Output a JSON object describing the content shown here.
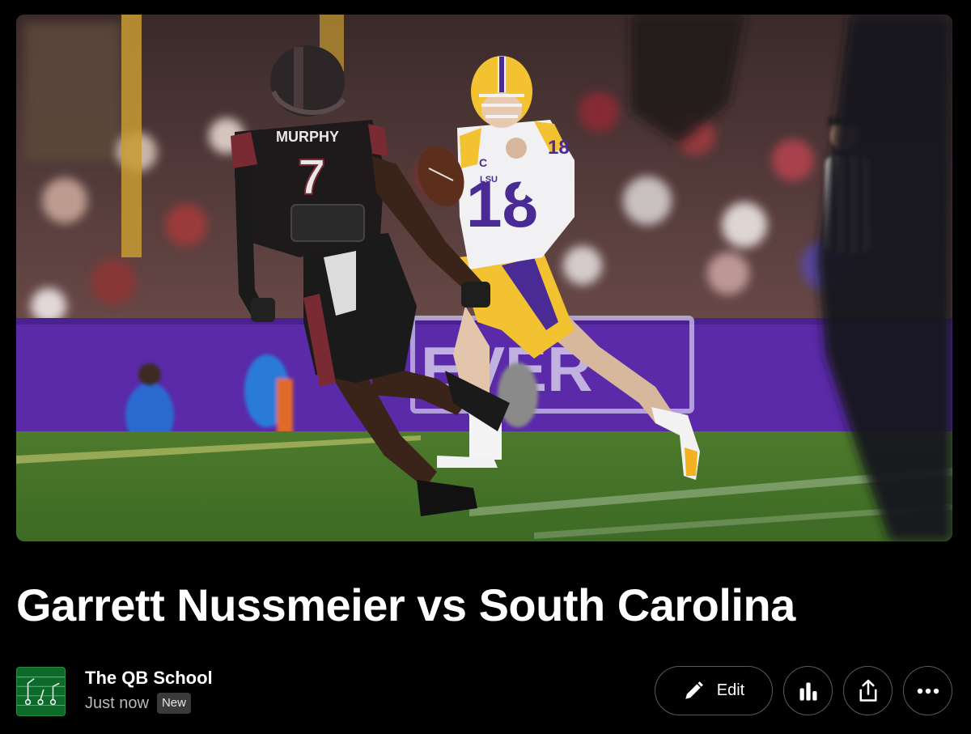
{
  "post": {
    "title": "Garrett Nussmeier vs South Carolina"
  },
  "hero_image": {
    "player_left": {
      "name": "MURPHY",
      "number": "7"
    },
    "player_right": {
      "number": "18",
      "shoulder_number": "18",
      "chest_text": "LSU",
      "captain_patch": "C"
    },
    "banner_text": "EVER",
    "colors": {
      "jersey_dark": "#1e1a1c",
      "jersey_white": "#f1f1f4",
      "lsu_purple": "#4a2a95",
      "lsu_gold": "#f2c230",
      "wall_purple": "#5a2aa8",
      "grass": "#4f7a2e"
    }
  },
  "byline": {
    "publication": "The QB School",
    "timestamp": "Just now",
    "badge": "New"
  },
  "actions": {
    "edit_label": "Edit",
    "stats_icon": "bar-chart-icon",
    "share_icon": "share-icon",
    "more_icon": "more-horizontal-icon"
  }
}
